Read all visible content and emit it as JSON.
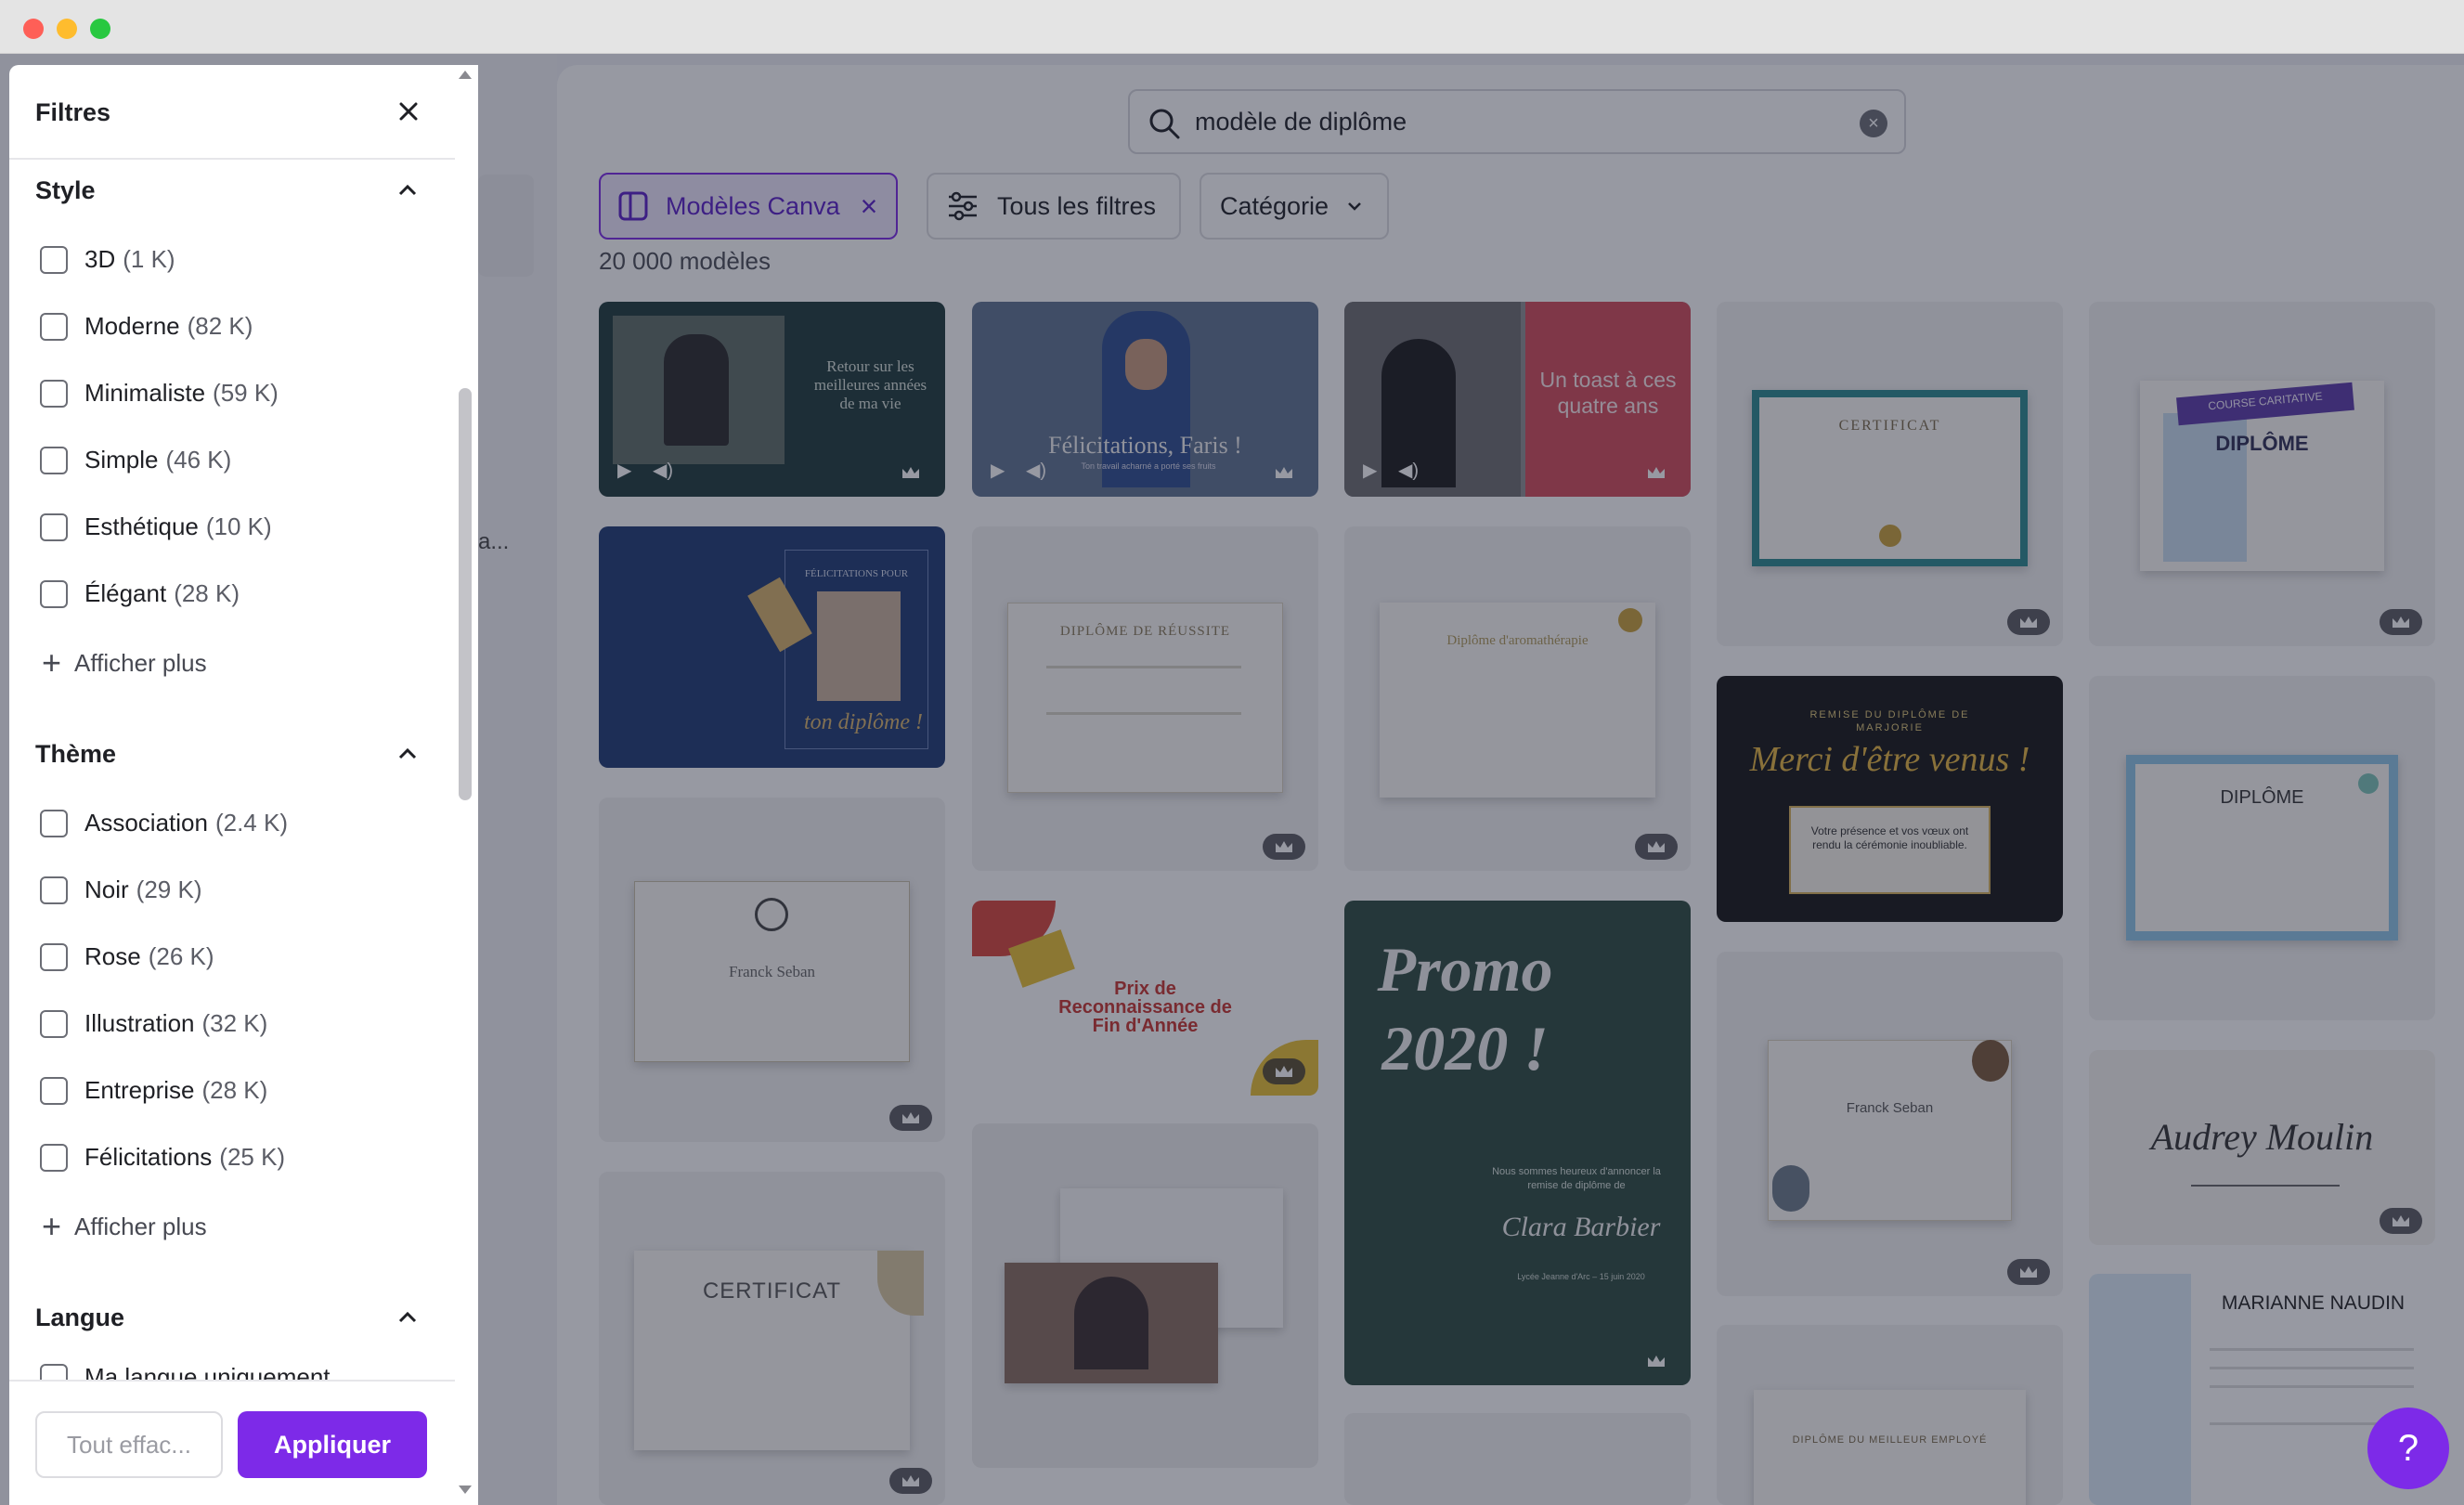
{
  "colors": {
    "accent": "#7d2ae8",
    "accent_soft": "#efe7fd",
    "overlay": "#1c2034"
  },
  "search": {
    "value": "modèle de diplôme"
  },
  "chips": {
    "canva": "Modèles Canva",
    "all_filters": "Tous les filtres",
    "category": "Catégorie"
  },
  "results": {
    "count": "20 000 modèles"
  },
  "rail": {
    "truncated": "a..."
  },
  "filters": {
    "title": "Filtres",
    "style": {
      "title": "Style",
      "options": [
        {
          "label": "3D",
          "count": "(1 K)"
        },
        {
          "label": "Moderne",
          "count": "(82 K)"
        },
        {
          "label": "Minimaliste",
          "count": "(59 K)"
        },
        {
          "label": "Simple",
          "count": "(46 K)"
        },
        {
          "label": "Esthétique",
          "count": "(10 K)"
        },
        {
          "label": "Élégant",
          "count": "(28 K)"
        }
      ],
      "more": "Afficher plus"
    },
    "theme": {
      "title": "Thème",
      "options": [
        {
          "label": "Association",
          "count": "(2.4 K)"
        },
        {
          "label": "Noir",
          "count": "(29 K)"
        },
        {
          "label": "Rose",
          "count": "(26 K)"
        },
        {
          "label": "Illustration",
          "count": "(32 K)"
        },
        {
          "label": "Entreprise",
          "count": "(28 K)"
        },
        {
          "label": "Félicitations",
          "count": "(25 K)"
        }
      ],
      "more": "Afficher plus"
    },
    "language": {
      "title": "Langue",
      "options": [
        {
          "label": "Ma langue uniquement"
        }
      ]
    },
    "clear_label": "Tout effac...",
    "apply_label": "Appliquer"
  },
  "cards": {
    "c1": "Retour sur les meilleures années de ma vie",
    "c2": "Félicitations, Faris !",
    "c2sub": "Ton travail acharné a porté ses fruits",
    "c3": "Un toast à ces quatre ans",
    "c4": "CERTIFICAT",
    "c5": "COURSE CARITATIVE",
    "c5b": "DIPLÔME",
    "c6a": "FÉLICITATIONS POUR",
    "c6b": "ton diplôme !",
    "c7": "DIPLÔME DE RÉUSSITE",
    "c8": "Diplôme d'aromathérapie",
    "c9a": "REMISE DU DIPLÔME DE MARJORIE",
    "c9b": "Merci d'être venus !",
    "c9c": "Votre présence et vos vœux ont rendu la cérémonie inoubliable.",
    "c10": "DIPLÔME",
    "c11": "Franck Seban",
    "c12a": "Prix de Reconnaissance de Fin d'Année",
    "c13a": "Promo",
    "c13b": "2020 !",
    "c13c": "Nous sommes heureux d'annoncer la remise de diplôme de",
    "c13d": "Clara Barbier",
    "c13e": "Lycée Jeanne d'Arc – 15 juin 2020",
    "c14": "Franck Seban",
    "c15": "Audrey Moulin",
    "c16": "CERTIFICAT",
    "c17": "DIPLÔME DU MEILLEUR EMPLOYÉ",
    "c18": "MARIANNE NAUDIN"
  },
  "help": {
    "label": "?"
  }
}
